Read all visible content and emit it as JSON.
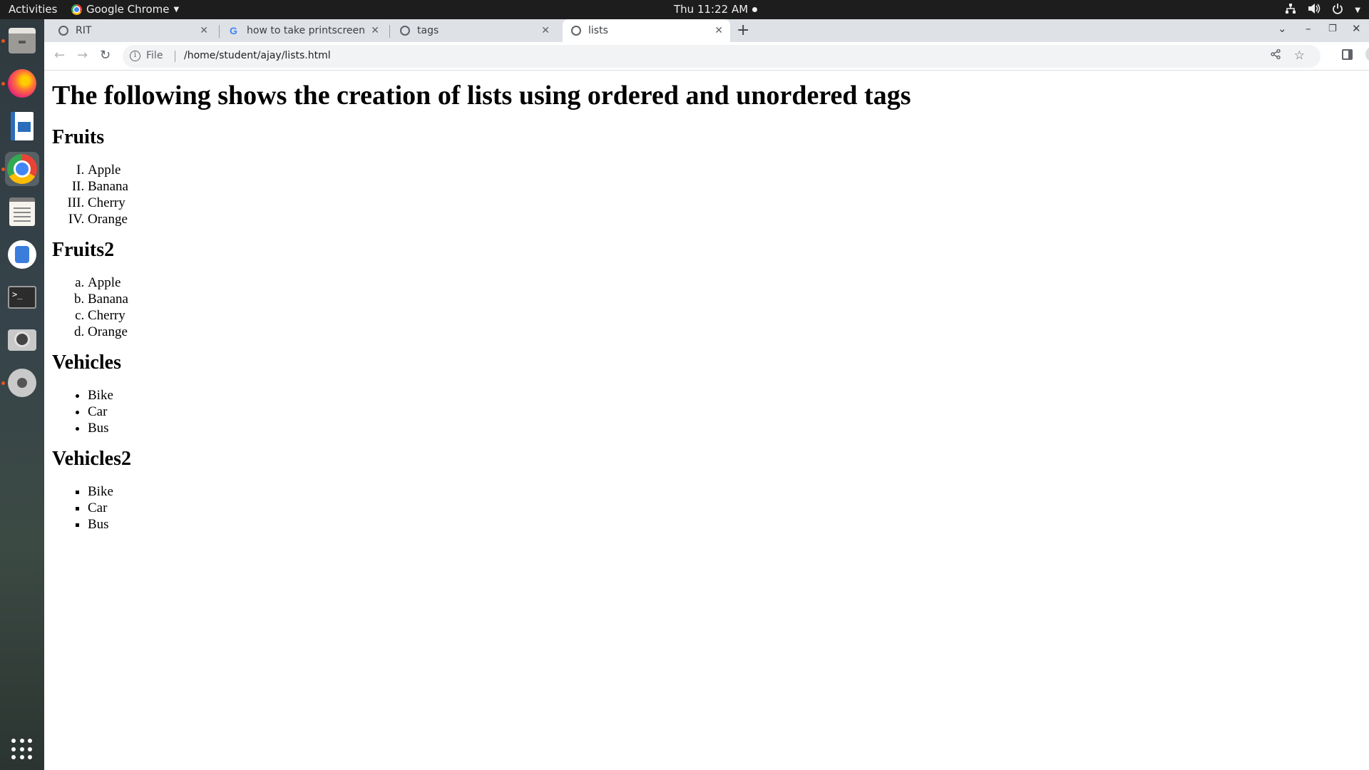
{
  "topbar": {
    "activities": "Activities",
    "app_name": "Google Chrome",
    "clock": "Thu 11:22 AM"
  },
  "dock": {
    "items": [
      "files-icon",
      "firefox-icon",
      "libreoffice-writer-icon",
      "chrome-icon",
      "text-editor-icon",
      "android-studio-icon",
      "terminal-icon",
      "screenshot-icon",
      "settings-icon",
      "show-apps-icon"
    ]
  },
  "tabs": [
    {
      "title": "RIT"
    },
    {
      "title": "how to take printscreen i"
    },
    {
      "title": "tags"
    },
    {
      "title": "lists"
    }
  ],
  "omnibox": {
    "scheme": "File",
    "url": "/home/student/ajay/lists.html"
  },
  "page": {
    "heading": "The following shows the creation of lists using ordered and unordered tags",
    "sections": [
      {
        "title": "Fruits",
        "items": [
          "Apple",
          "Banana",
          "Cherry",
          "Orange"
        ]
      },
      {
        "title": "Fruits2",
        "items": [
          "Apple",
          "Banana",
          "Cherry",
          "Orange"
        ]
      },
      {
        "title": "Vehicles",
        "items": [
          "Bike",
          "Car",
          "Bus"
        ]
      },
      {
        "title": "Vehicles2",
        "items": [
          "Bike",
          "Car",
          "Bus"
        ]
      }
    ]
  }
}
